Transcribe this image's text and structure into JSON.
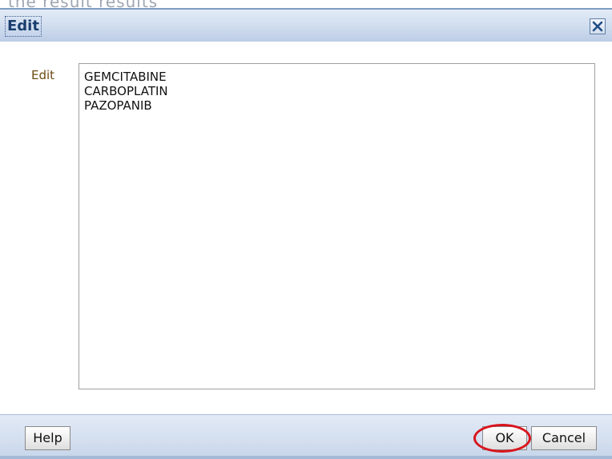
{
  "background_text": "the result results",
  "dialog": {
    "title": "Edit",
    "close_icon": "close-icon"
  },
  "form": {
    "label": "Edit",
    "value": "GEMCITABINE\nCARBOPLATIN\nPAZOPANIB"
  },
  "footer": {
    "help_label": "Help",
    "ok_label": "OK",
    "cancel_label": "Cancel"
  },
  "colors": {
    "title_bar": "#cfdcee",
    "title_text": "#1a3d6e",
    "label_text": "#6b4a14",
    "annotation_ring": "#d9141c"
  }
}
